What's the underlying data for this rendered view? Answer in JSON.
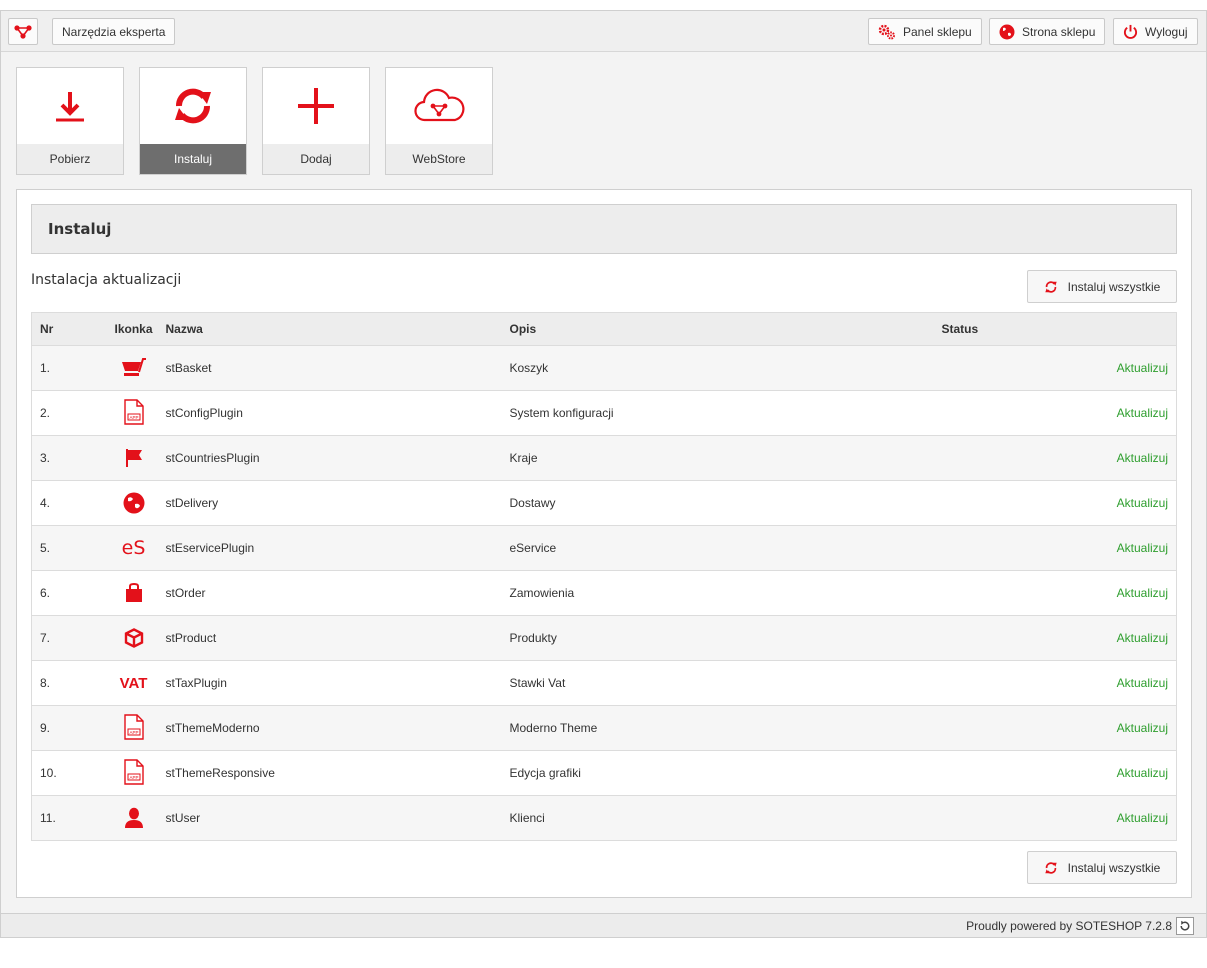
{
  "topbar": {
    "logo_icon": "share-logo-icon",
    "expert_tools_label": "Narzędzia eksperta",
    "shop_panel_label": "Panel sklepu",
    "shop_site_label": "Strona sklepu",
    "logout_label": "Wyloguj"
  },
  "tiles": [
    {
      "label": "Pobierz",
      "icon": "download-icon",
      "active": false
    },
    {
      "label": "Instaluj",
      "icon": "refresh-icon",
      "active": true
    },
    {
      "label": "Dodaj",
      "icon": "plus-icon",
      "active": false
    },
    {
      "label": "WebStore",
      "icon": "cloud-share-icon",
      "active": false
    }
  ],
  "panel": {
    "title": "Instaluj",
    "section_title": "Instalacja aktualizacji",
    "install_all_label": "Instaluj wszystkie"
  },
  "table": {
    "headers": {
      "nr": "Nr",
      "icon": "Ikonka",
      "name": "Nazwa",
      "desc": "Opis",
      "status": "Status"
    },
    "rows": [
      {
        "nr": "1.",
        "icon": "basket-icon",
        "name": "stBasket",
        "desc": "Koszyk",
        "status": "Aktualizuj"
      },
      {
        "nr": "2.",
        "icon": "app-file-icon",
        "name": "stConfigPlugin",
        "desc": "System konfiguracji",
        "status": "Aktualizuj"
      },
      {
        "nr": "3.",
        "icon": "flag-icon",
        "name": "stCountriesPlugin",
        "desc": "Kraje",
        "status": "Aktualizuj"
      },
      {
        "nr": "4.",
        "icon": "globe-icon",
        "name": "stDelivery",
        "desc": "Dostawy",
        "status": "Aktualizuj"
      },
      {
        "nr": "5.",
        "icon": "eservice-icon",
        "name": "stEservicePlugin",
        "desc": "eService",
        "status": "Aktualizuj"
      },
      {
        "nr": "6.",
        "icon": "bag-icon",
        "name": "stOrder",
        "desc": "Zamowienia",
        "status": "Aktualizuj"
      },
      {
        "nr": "7.",
        "icon": "box-icon",
        "name": "stProduct",
        "desc": "Produkty",
        "status": "Aktualizuj"
      },
      {
        "nr": "8.",
        "icon": "vat-icon",
        "name": "stTaxPlugin",
        "desc": "Stawki Vat",
        "status": "Aktualizuj"
      },
      {
        "nr": "9.",
        "icon": "app-file-icon",
        "name": "stThemeModerno",
        "desc": "Moderno Theme",
        "status": "Aktualizuj"
      },
      {
        "nr": "10.",
        "icon": "app-file-icon",
        "name": "stThemeResponsive",
        "desc": "Edycja grafiki",
        "status": "Aktualizuj"
      },
      {
        "nr": "11.",
        "icon": "user-icon",
        "name": "stUser",
        "desc": "Klienci",
        "status": "Aktualizuj"
      }
    ]
  },
  "icon_text": {
    "eservice": "eS",
    "vat": "VAT",
    "app": "APP"
  },
  "footer": {
    "text": "Proudly powered by SOTESHOP 7.2.8"
  },
  "colors": {
    "accent": "#e3111a",
    "status": "#2e9e2e",
    "active_tile": "#6e6e6e"
  }
}
